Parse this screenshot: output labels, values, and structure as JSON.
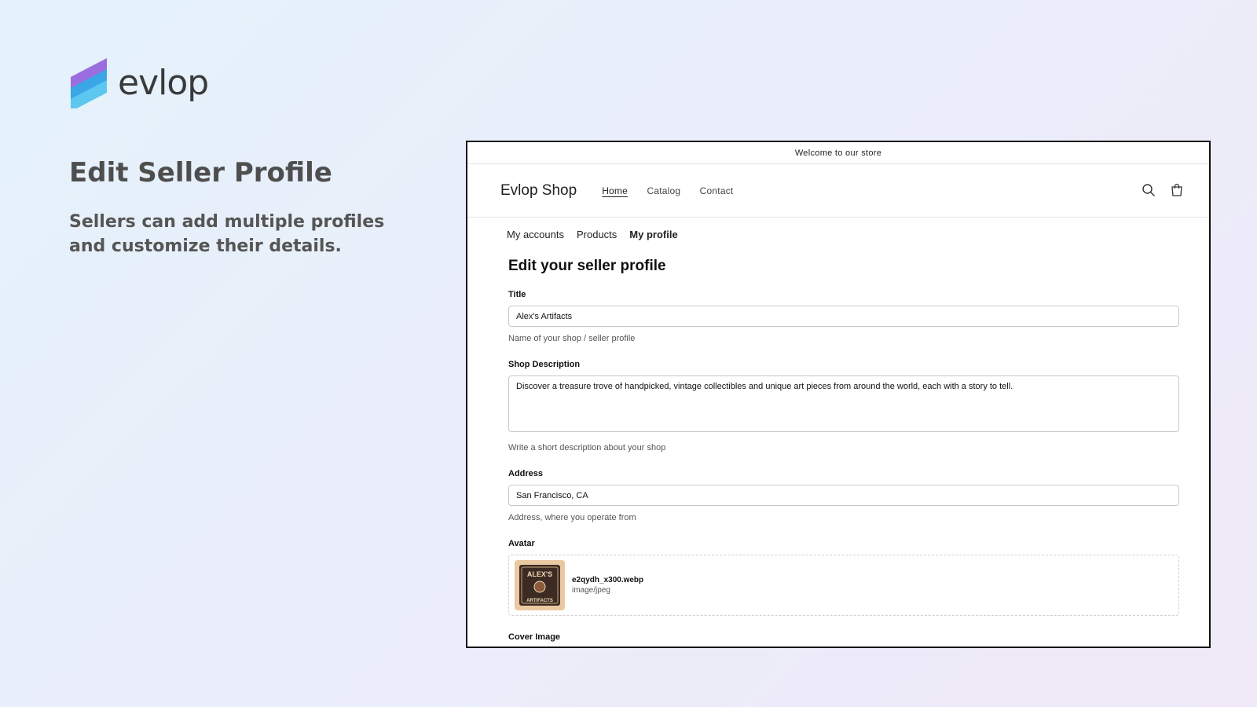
{
  "brand": {
    "name": "evlop",
    "colors": {
      "purple": "#9b6ee0",
      "blue": "#3aa6e6",
      "light_blue": "#5cc7ef"
    }
  },
  "promo": {
    "title": "Edit Seller Profile",
    "subtitle": "Sellers can add multiple profiles and customize their details."
  },
  "store": {
    "announcement": "Welcome to our store",
    "name": "Evlop Shop",
    "nav": [
      "Home",
      "Catalog",
      "Contact"
    ],
    "active_nav": "Home",
    "icons": [
      "search-icon",
      "cart-icon"
    ]
  },
  "account_nav": {
    "items": [
      "My accounts",
      "Products",
      "My profile"
    ],
    "current": "My profile"
  },
  "form": {
    "heading": "Edit your seller profile",
    "title": {
      "label": "Title",
      "value": "Alex's Artifacts",
      "help": "Name of your shop / seller profile"
    },
    "description": {
      "label": "Shop Description",
      "value": "Discover a treasure trove of handpicked, vintage collectibles and unique art pieces from around the world, each with a story to tell.",
      "help": "Write a short description about your shop"
    },
    "address": {
      "label": "Address",
      "value": "San Francisco, CA",
      "help": "Address, where you operate from"
    },
    "avatar": {
      "label": "Avatar",
      "file_name": "e2qydh_x300.webp",
      "file_type": "image/jpeg",
      "image_text": [
        "ALEX'S",
        "ARTIFACTS"
      ]
    },
    "cover": {
      "label": "Cover Image"
    }
  }
}
